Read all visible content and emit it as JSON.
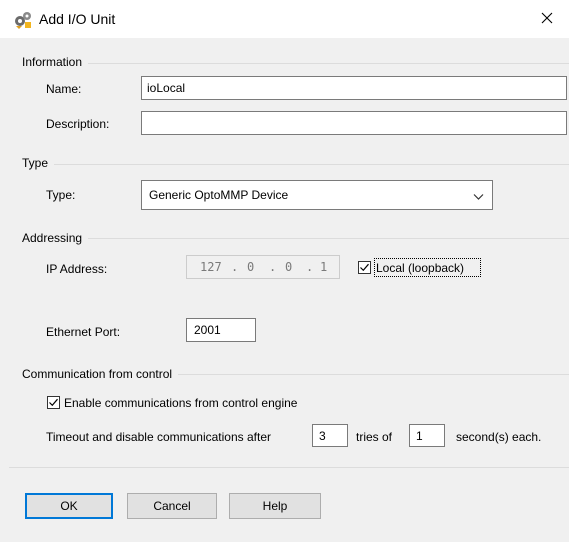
{
  "window": {
    "title": "Add I/O Unit",
    "icon": "gears-icon",
    "close_icon": "close-icon"
  },
  "information": {
    "group_label": "Information",
    "name_label": "Name:",
    "name_value": "ioLocal",
    "description_label": "Description:",
    "description_value": ""
  },
  "type": {
    "group_label": "Type",
    "type_label": "Type:",
    "selected": "Generic OptoMMP Device"
  },
  "addressing": {
    "group_label": "Addressing",
    "ip_label": "IP Address:",
    "ip_octets": [
      "127",
      "0",
      "0",
      "1"
    ],
    "ip_dot": ".",
    "local_label": "Local (loopback)",
    "local_checked": true,
    "port_label": "Ethernet Port:",
    "port_value": "2001"
  },
  "communication": {
    "group_label": "Communication from control",
    "enable_label": "Enable communications from control engine",
    "enable_checked": true,
    "timeout_prefix": "Timeout and disable communications after",
    "tries_value": "3",
    "tries_label": "tries of",
    "seconds_value": "1",
    "seconds_label": "second(s) each."
  },
  "buttons": {
    "ok": "OK",
    "cancel": "Cancel",
    "help": "Help"
  },
  "colors": {
    "default_button_border": "#0078d7",
    "dialog_bg": "#f0f0f0"
  }
}
